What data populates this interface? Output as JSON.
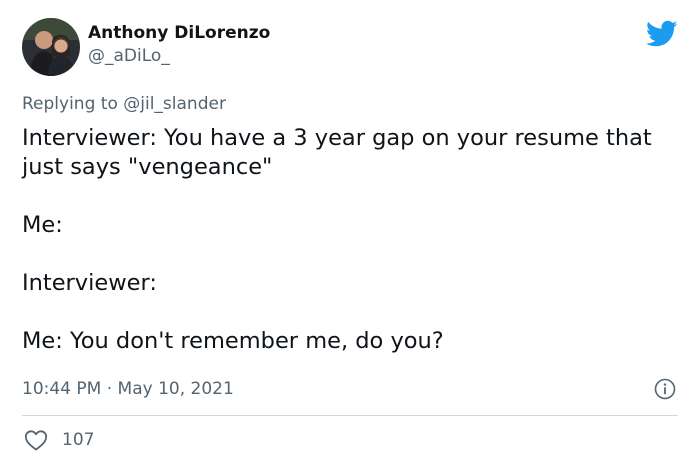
{
  "author": {
    "display_name": "Anthony DiLorenzo",
    "handle": "@_aDiLo_"
  },
  "reply": {
    "prefix": "Replying to",
    "to": "@jil_slander"
  },
  "body": {
    "lines": [
      "Interviewer: You have a 3 year gap on your resume that just says \"vengeance\"",
      "Me:",
      "Interviewer:",
      "Me: You don't remember me, do you?"
    ]
  },
  "meta": {
    "timestamp": "10:44 PM · May 10, 2021"
  },
  "engagement": {
    "likes": "107"
  },
  "icons": {
    "brand": "twitter-bird-icon",
    "info": "info-icon",
    "like": "heart-icon"
  },
  "colors": {
    "brand_blue": "#1d9bf0",
    "secondary_text": "#536471",
    "divider": "#cfd9de"
  }
}
